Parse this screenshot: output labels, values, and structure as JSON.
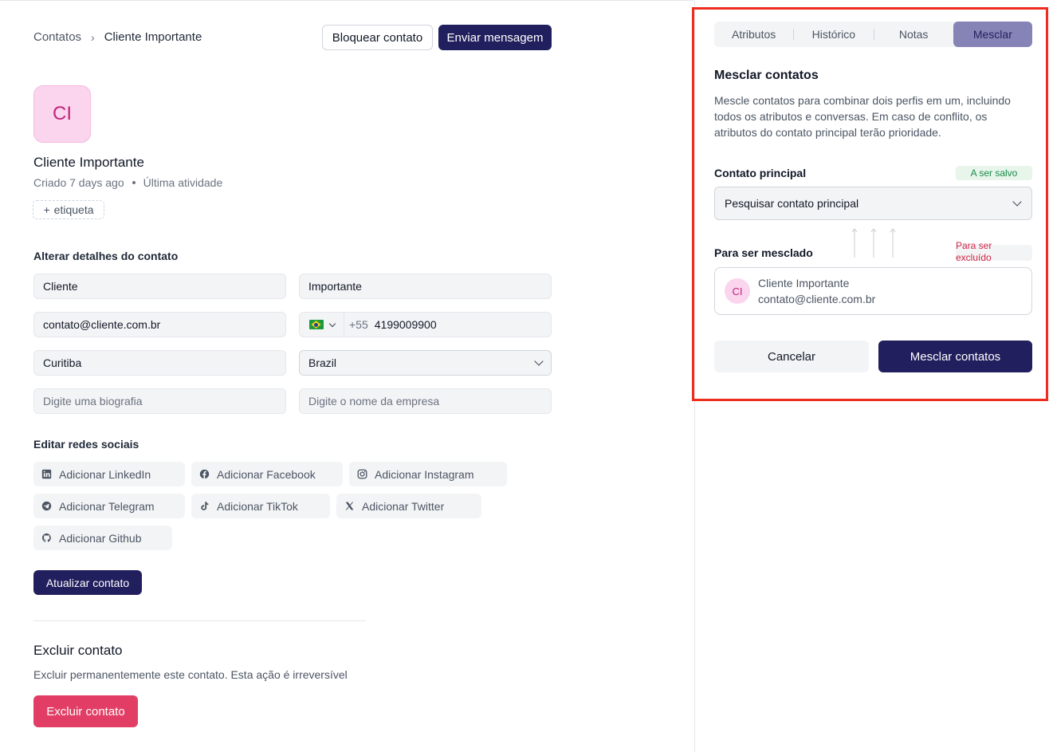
{
  "breadcrumb": {
    "parent": "Contatos",
    "current": "Cliente Importante"
  },
  "header": {
    "block_label": "Bloquear contato",
    "send_label": "Enviar mensagem"
  },
  "contact": {
    "initials": "CI",
    "name": "Cliente Importante",
    "created": "Criado 7 days ago",
    "last_activity": "Última atividade",
    "tag_label": "etiqueta"
  },
  "details": {
    "title": "Alterar detalhes do contato",
    "first_name": "Cliente",
    "last_name": "Importante",
    "email": "contato@cliente.com.br",
    "phone_code": "+55",
    "phone_number": "4199009900",
    "city": "Curitiba",
    "country": "Brazil",
    "bio_placeholder": "Digite uma biografia",
    "company_placeholder": "Digite o nome da empresa"
  },
  "social": {
    "title": "Editar redes sociais",
    "items": [
      {
        "label": "Adicionar LinkedIn",
        "icon": "linkedin-icon"
      },
      {
        "label": "Adicionar Facebook",
        "icon": "facebook-icon"
      },
      {
        "label": "Adicionar Instagram",
        "icon": "instagram-icon"
      },
      {
        "label": "Adicionar Telegram",
        "icon": "telegram-icon"
      },
      {
        "label": "Adicionar TikTok",
        "icon": "tiktok-icon"
      },
      {
        "label": "Adicionar Twitter",
        "icon": "twitter-x-icon"
      },
      {
        "label": "Adicionar Github",
        "icon": "github-icon"
      }
    ]
  },
  "update_label": "Atualizar contato",
  "delete": {
    "title": "Excluir contato",
    "description": "Excluir permanentemente este contato. Esta ação é irreversível",
    "button": "Excluir contato"
  },
  "panel": {
    "tabs": [
      {
        "label": "Atributos",
        "active": false
      },
      {
        "label": "Histórico",
        "active": false
      },
      {
        "label": "Notas",
        "active": false
      },
      {
        "label": "Mesclar",
        "active": true
      }
    ],
    "merge_title": "Mesclar contatos",
    "merge_description": "Mescle contatos para combinar dois perfis em um, incluindo todos os atributos e conversas. Em caso de conflito, os atributos do contato principal terão prioridade.",
    "primary_label": "Contato principal",
    "primary_badge": "A ser salvo",
    "primary_placeholder": "Pesquisar contato principal",
    "merged_label": "Para ser mesclado",
    "merged_badge": "Para ser excluído",
    "merged_contact": {
      "initials": "CI",
      "name": "Cliente Importante",
      "email": "contato@cliente.com.br"
    },
    "cancel_label": "Cancelar",
    "merge_button": "Mesclar contatos"
  },
  "colors": {
    "primary": "#221f5e",
    "danger": "#e23d65",
    "highlight_frame": "#ef2d1f",
    "avatar_bg": "#fbd5ee",
    "active_tab": "#8683b6"
  }
}
